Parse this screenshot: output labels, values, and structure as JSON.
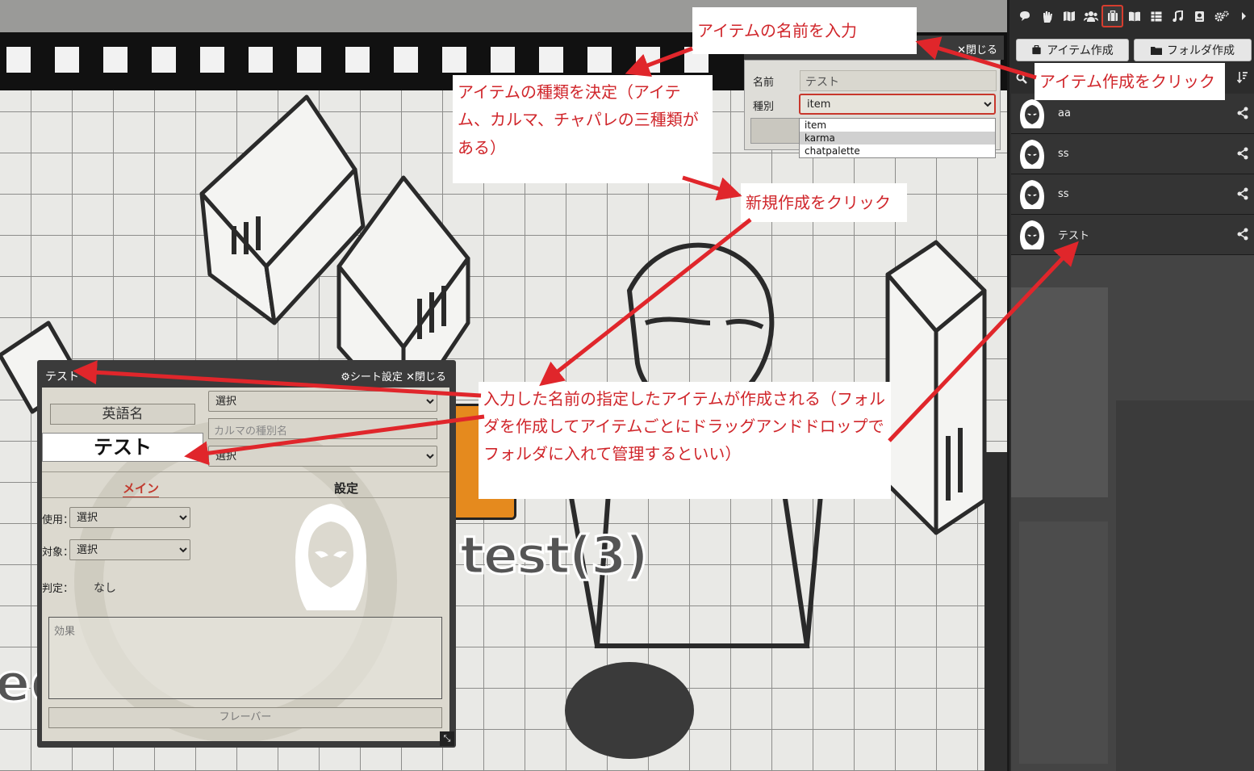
{
  "board": {
    "token_label": "test(3)",
    "partial_label": "ed"
  },
  "sidebar": {
    "tools": [
      "chat-icon",
      "hand-icon",
      "map-icon",
      "users-icon",
      "item-box-icon",
      "book-icon",
      "table-icon",
      "music-icon",
      "note-icon",
      "gears-icon",
      "chevron-right-icon"
    ],
    "active_tool": "item-box-icon",
    "create_item_label": "アイテム作成",
    "create_folder_label": "フォルダ作成",
    "items": [
      {
        "name": "aa"
      },
      {
        "name": "ss"
      },
      {
        "name": "ss"
      },
      {
        "name": "テスト"
      }
    ]
  },
  "create_panel": {
    "close_label": "閉じる",
    "name_label": "名前",
    "name_value": "テスト",
    "type_label": "種別",
    "type_value": "item",
    "type_options": [
      "item",
      "karma",
      "chatpalette"
    ],
    "highlighted_option": "karma"
  },
  "sheet": {
    "title": "テスト",
    "settings_label": "シート設定",
    "close_label": "閉じる",
    "english_name": "英語名",
    "name": "テスト",
    "select_placeholder": "選択",
    "karma_type_placeholder": "カルマの種別名",
    "tab_main": "メイン",
    "tab_settings": "設定",
    "use_label": "使用：",
    "target_label": "対象：",
    "judge_label": "判定：",
    "judge_value": "なし",
    "effect_placeholder": "効果",
    "flavor_placeholder": "フレーバー"
  },
  "annotations": {
    "enter_name": "アイテムの名前を入力",
    "click_create": "アイテム作成をクリック",
    "decide_type": "アイテムの種類を決定（アイテム、カルマ、チャパレの三種類がある）",
    "click_new": "新規作成をクリック",
    "result": "入力した名前の指定したアイテムが作成される（フォルダを作成してアイテムごとにドラッグアンドドロップでフォルダに入れて管理するといい）"
  },
  "colors": {
    "annotation_red": "#d0262b",
    "arrow_red": "#e0262b",
    "sidebar_bg": "#2c2c2c",
    "active_tool_border": "#d63d2e"
  }
}
